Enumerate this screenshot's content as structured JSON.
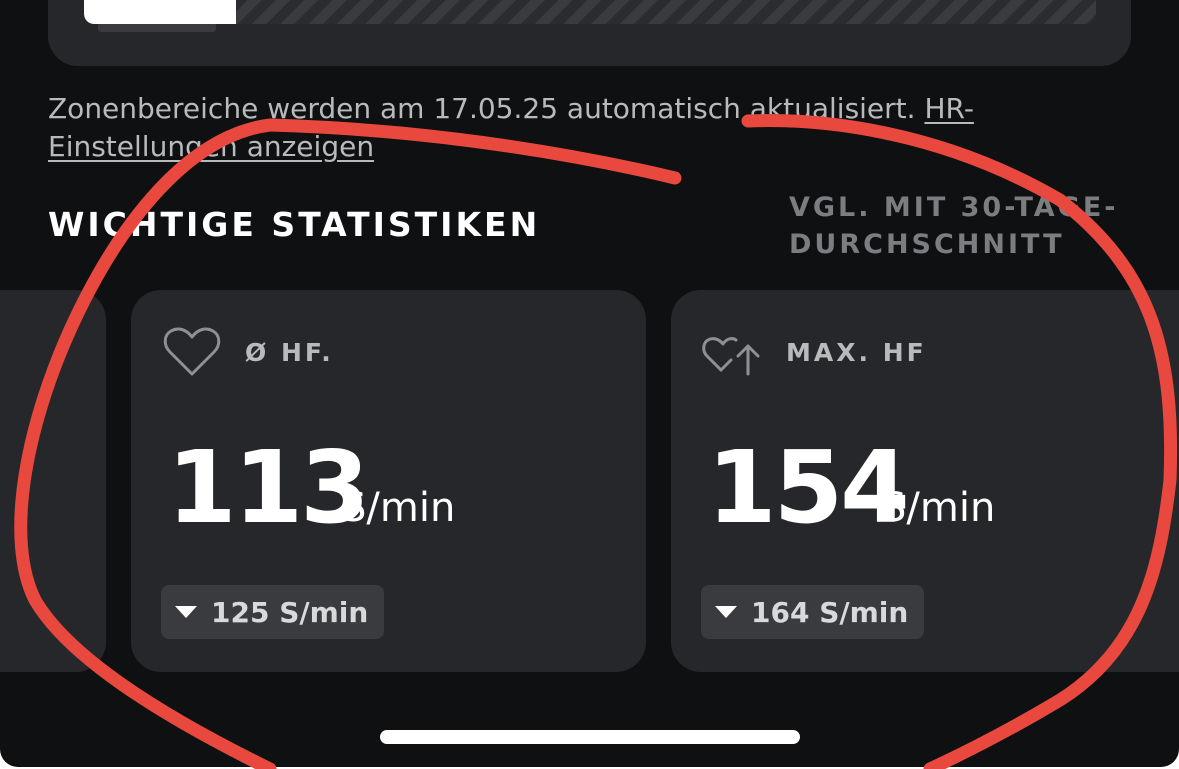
{
  "zone_note": {
    "text": "Zonenbereiche werden am 17.05.25 automatisch aktualisiert. ",
    "link": "HR-Einstellungen anzeigen"
  },
  "zone_bar": {
    "fill_fraction": 0.15
  },
  "stats": {
    "section_title": "WICHTIGE STATISTIKEN",
    "compare_label": "VGL. MIT 30-TAGE-DURCHSCHNITT",
    "cards": [
      {
        "icon": "heart-icon",
        "label": "Ø HF.",
        "value": "113",
        "unit": "S/min",
        "compare": "125 S/min",
        "trend": "down"
      },
      {
        "icon": "heart-arrow-up-icon",
        "label": "MAX. HF",
        "value": "154",
        "unit": "S/min",
        "compare": "164 S/min",
        "trend": "down"
      }
    ]
  },
  "annotation_color": "#e8483d"
}
